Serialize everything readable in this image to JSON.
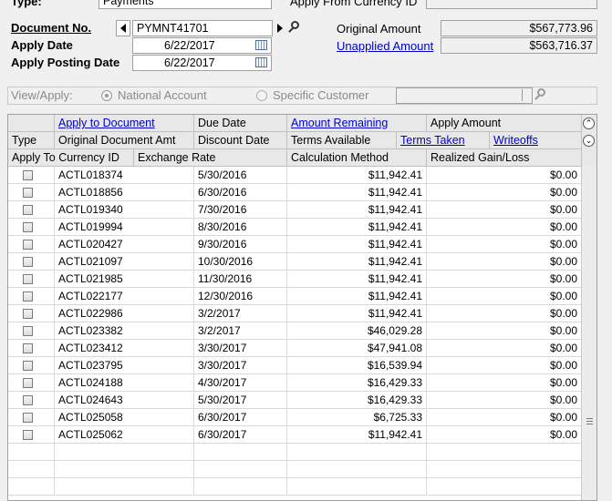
{
  "header": {
    "type_label": "Type:",
    "type_value": "Payments",
    "apply_from_currency_label": "Apply From Currency ID",
    "document_no_label": "Document No.",
    "document_no_value": "PYMNT41701",
    "apply_date_label": "Apply Date",
    "apply_date_value": "6/22/2017",
    "apply_posting_date_label": "Apply Posting Date",
    "apply_posting_date_value": "6/22/2017",
    "original_amount_label": "Original Amount",
    "original_amount_value": "$567,773.96",
    "unapplied_amount_label": "Unapplied Amount",
    "unapplied_amount_value": "$563,716.37"
  },
  "view_apply": {
    "label": "View/Apply:",
    "option_national": "National Account",
    "option_specific": "Specific Customer"
  },
  "grid": {
    "header_row1": [
      "",
      "Apply to Document",
      "Due Date",
      "Amount Remaining",
      "Apply Amount"
    ],
    "header_row2": [
      "Type",
      "Original Document Amt",
      "Discount Date",
      "Terms Available",
      "Terms Taken",
      "Writeoffs"
    ],
    "header_row3": [
      "Apply To Currency ID",
      "Exchange Rate",
      "Calculation Method",
      "Realized Gain/Loss"
    ],
    "rows": [
      {
        "doc": "ACTL018374",
        "due": "5/30/2016",
        "remaining": "$11,942.41",
        "apply": "$0.00"
      },
      {
        "doc": "ACTL018856",
        "due": "6/30/2016",
        "remaining": "$11,942.41",
        "apply": "$0.00"
      },
      {
        "doc": "ACTL019340",
        "due": "7/30/2016",
        "remaining": "$11,942.41",
        "apply": "$0.00"
      },
      {
        "doc": "ACTL019994",
        "due": "8/30/2016",
        "remaining": "$11,942.41",
        "apply": "$0.00"
      },
      {
        "doc": "ACTL020427",
        "due": "9/30/2016",
        "remaining": "$11,942.41",
        "apply": "$0.00"
      },
      {
        "doc": "ACTL021097",
        "due": "10/30/2016",
        "remaining": "$11,942.41",
        "apply": "$0.00"
      },
      {
        "doc": "ACTL021985",
        "due": "11/30/2016",
        "remaining": "$11,942.41",
        "apply": "$0.00"
      },
      {
        "doc": "ACTL022177",
        "due": "12/30/2016",
        "remaining": "$11,942.41",
        "apply": "$0.00"
      },
      {
        "doc": "ACTL022986",
        "due": "3/2/2017",
        "remaining": "$11,942.41",
        "apply": "$0.00"
      },
      {
        "doc": "ACTL023382",
        "due": "3/2/2017",
        "remaining": "$46,029.28",
        "apply": "$0.00"
      },
      {
        "doc": "ACTL023412",
        "due": "3/30/2017",
        "remaining": "$47,941.08",
        "apply": "$0.00"
      },
      {
        "doc": "ACTL023795",
        "due": "3/30/2017",
        "remaining": "$16,539.94",
        "apply": "$0.00"
      },
      {
        "doc": "ACTL024188",
        "due": "4/30/2017",
        "remaining": "$16,429.33",
        "apply": "$0.00"
      },
      {
        "doc": "ACTL024643",
        "due": "5/30/2017",
        "remaining": "$16,429.33",
        "apply": "$0.00"
      },
      {
        "doc": "ACTL025058",
        "due": "6/30/2017",
        "remaining": "$6,725.33",
        "apply": "$0.00"
      },
      {
        "doc": "ACTL025062",
        "due": "6/30/2017",
        "remaining": "$11,942.41",
        "apply": "$0.00"
      }
    ]
  }
}
